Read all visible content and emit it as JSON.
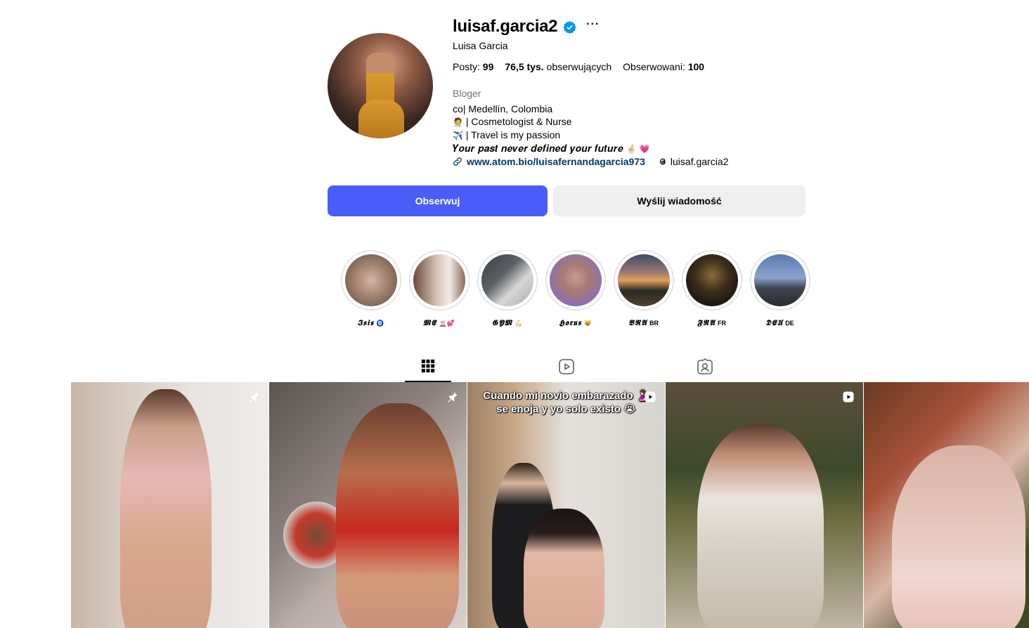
{
  "profile": {
    "username": "luisaf.garcia2",
    "full_name": "Luisa Garcia",
    "more_label": "···",
    "stats": {
      "posts_label": "Posty:",
      "posts_value": "99",
      "followers_value": "76,5 tys.",
      "followers_label": "obserwujących",
      "following_label": "Obserwowani:",
      "following_value": "100"
    },
    "category": "Bloger",
    "bio": {
      "line1": "co| Medellín, Colombia",
      "line2_emoji": "🧑‍⚕️",
      "line2_text": "| Cosmetologist & Nurse",
      "line3_emoji": "✈️",
      "line3_text": "| Travel is my passion",
      "line4_text": "𝒀𝒐𝒖𝒓 𝒑𝒂𝒔𝒕 𝒏𝒆𝒗𝒆𝒓 𝒅𝒆𝒇𝒊𝒏𝒆𝒅 𝒚𝒐𝒖𝒓 𝒇𝒖𝒕𝒖𝒓𝒆",
      "line4_emoji": "🤞🏻 💗"
    },
    "website": "www.atom.bio/luisafernandagarcia973",
    "threads_handle": "luisaf.garcia2"
  },
  "actions": {
    "follow_label": "Obserwuj",
    "message_label": "Wyślij wiadomość"
  },
  "highlights": [
    {
      "label": "𝕴𝖘𝖎𝖘",
      "suffix": "🧿"
    },
    {
      "label": "𝕸𝕰",
      "suffix": "🧝🏻‍♀️💕"
    },
    {
      "label": "𝕲𝖄𝕸",
      "suffix": "💪🏻"
    },
    {
      "label": "𝕳𝖔𝖗𝖚𝖘",
      "suffix": "😺"
    },
    {
      "label": "𝕭𝕽𝕬",
      "suffix": "BR"
    },
    {
      "label": "𝕱𝕽𝕬",
      "suffix": "FR"
    },
    {
      "label": "𝕯𝕰𝖀",
      "suffix": "DE"
    }
  ],
  "tabs": [
    {
      "icon": "grid-icon",
      "active": true
    },
    {
      "icon": "reels-icon",
      "active": false
    },
    {
      "icon": "tagged-icon",
      "active": false
    }
  ],
  "posts": [
    {
      "badge": "pin-icon",
      "caption": ""
    },
    {
      "badge": "pin-icon",
      "caption": ""
    },
    {
      "badge": "reel-icon",
      "caption_line1": "Cuando mi novio embarazado 🤰",
      "caption_line2": "se enoja y yo solo existo 😭"
    },
    {
      "badge": "reel-icon",
      "caption": ""
    },
    {
      "badge": "",
      "caption": ""
    }
  ],
  "colors": {
    "follow_button": "#4a5df9",
    "message_button": "#efefef",
    "link": "#00376b",
    "verified": "#0095f6"
  }
}
